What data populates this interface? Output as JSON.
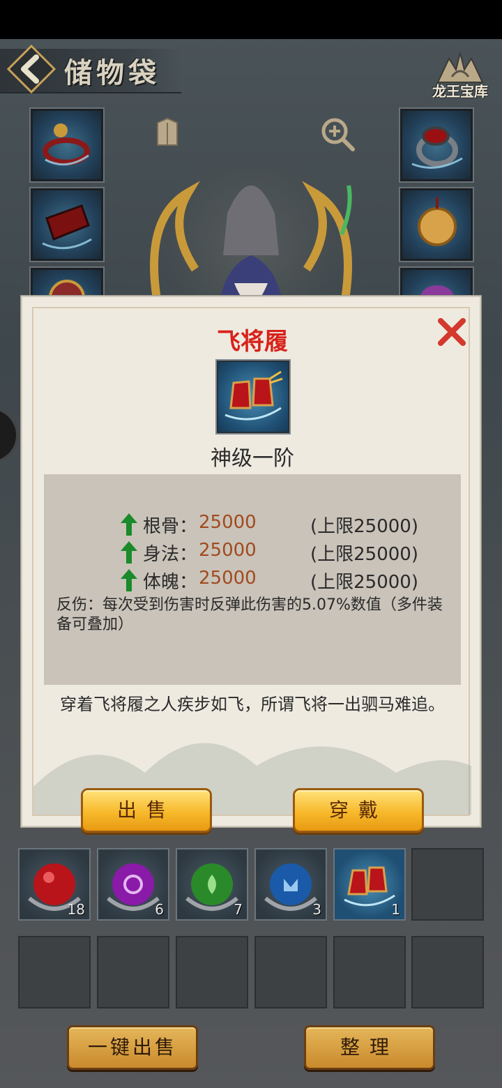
{
  "header": {
    "title": "储物袋",
    "treasury_label": "龙王宝库"
  },
  "modal": {
    "item_name": "飞将履",
    "grade": "神级一阶",
    "stats": [
      {
        "label": "根骨：",
        "value": "25000",
        "limit": "(上限25000)"
      },
      {
        "label": "身法：",
        "value": "25000",
        "limit": "(上限25000)"
      },
      {
        "label": "体魄：",
        "value": "25000",
        "limit": "(上限25000)"
      }
    ],
    "effect": "反伤：每次受到伤害时反弹此伤害的5.07%数值（多件装备可叠加）",
    "description": "穿着飞将履之人疾步如飞，所谓飞将一出驷马难追。",
    "sell_label": "出售",
    "equip_label": "穿戴"
  },
  "bag": {
    "items": [
      {
        "icon": "red-orb-icon",
        "count": "18"
      },
      {
        "icon": "purple-orb-icon",
        "count": "6"
      },
      {
        "icon": "green-orb-icon",
        "count": "7"
      },
      {
        "icon": "blue-orb-icon",
        "count": "3"
      },
      {
        "icon": "boots-icon",
        "count": "1"
      }
    ]
  },
  "footer": {
    "quick_sell_label": "一键出售",
    "sort_label": "整理"
  },
  "colors": {
    "item_name": "#d8221b",
    "stat_value": "#a14a1f",
    "stat_arrow": "#1a8a2a",
    "gold_button": "#f7b92b"
  }
}
